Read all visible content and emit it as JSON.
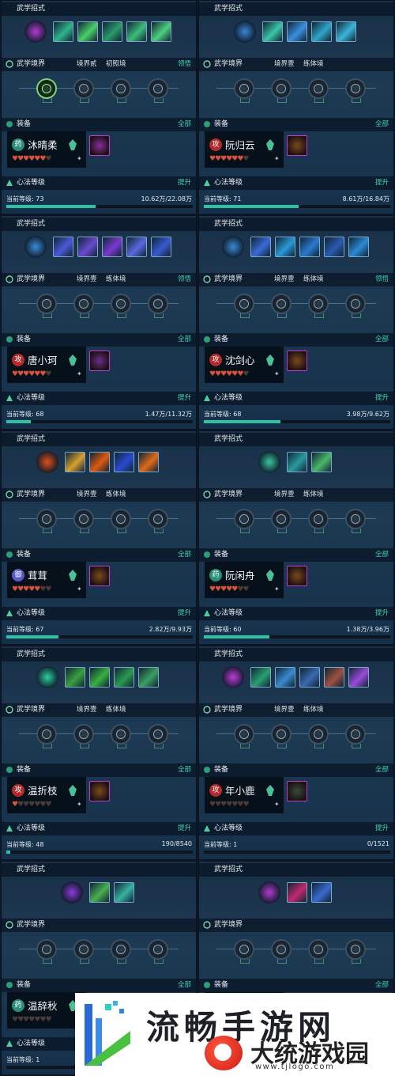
{
  "labels": {
    "skills": "武学招式",
    "realm": "武学境界",
    "equip": "装备",
    "heart": "心法等级",
    "current_level": "当前等级:",
    "insight": "领悟",
    "all": "全部",
    "upgrade": "提升"
  },
  "characters": [
    {
      "realm_a": "境界贰",
      "realm_b": "初照境",
      "show_insight": true,
      "name": "沐晴柔",
      "badge": "药",
      "badge_color": "#2a8f7a",
      "hearts_full": 6,
      "level": "73",
      "exp": "10.62万/22.08万",
      "progress": 0.48,
      "skill_colors": [
        "#b03ad0",
        "#2fb58a",
        "#4ccf6a",
        "#2a9b6a",
        "#3dbd7a",
        "#4fd07e"
      ],
      "gear_color": "#8a2e9c",
      "skill_count": 5
    },
    {
      "realm_a": "境界壹",
      "realm_b": "练体境",
      "show_insight": false,
      "name": "阮归云",
      "badge": "攻",
      "badge_color": "#b22a2a",
      "hearts_full": 6,
      "level": "71",
      "exp": "8.61万/16.84万",
      "progress": 0.51,
      "skill_colors": [
        "#3a86d8",
        "#3cc6a6",
        "#3a8fe0",
        "#2fa6c9",
        "#3ab6d8",
        "#3aa0e0"
      ],
      "gear_color": "#7a4a20",
      "skill_count": 4
    },
    {
      "realm_a": "境界壹",
      "realm_b": "练体境",
      "show_insight": true,
      "name": "唐小珂",
      "badge": "攻",
      "badge_color": "#b22a2a",
      "hearts_full": 6,
      "level": "68",
      "exp": "1.47万/11.32万",
      "progress": 0.13,
      "skill_colors": [
        "#3a8ad8",
        "#4a5ad8",
        "#6a4ad0",
        "#7a3ad0",
        "#5a6ae0",
        "#3a5ad0"
      ],
      "gear_color": "#6a2e8c",
      "skill_count": 5
    },
    {
      "realm_a": "境界壹",
      "realm_b": "练体境",
      "show_insight": true,
      "name": "沈剑心",
      "badge": "攻",
      "badge_color": "#b22a2a",
      "hearts_full": 6,
      "level": "68",
      "exp": "3.98万/9.62万",
      "progress": 0.41,
      "skill_colors": [
        "#3a8ad8",
        "#3a6ad8",
        "#2a9ad8",
        "#2a7ad0",
        "#2a5ab0",
        "#2a8ad8"
      ],
      "gear_color": "#7a4a20",
      "skill_count": 5
    },
    {
      "realm_a": "境界壹",
      "realm_b": "练体境",
      "show_insight": false,
      "name": "茸茸",
      "badge": "御",
      "badge_color": "#5a5ac8",
      "hearts_full": 5,
      "level": "67",
      "exp": "2.82万/9.93万",
      "progress": 0.28,
      "skill_colors": [
        "#e0501a",
        "#d8a030",
        "#e05a10",
        "#2a4ad0",
        "#e06a1a",
        "#000000"
      ],
      "gear_color": "#7a4a20",
      "skill_count": 4
    },
    {
      "realm_a": "境界壹",
      "realm_b": "练体境",
      "show_insight": false,
      "name": "阮闲舟",
      "badge": "药",
      "badge_color": "#2a8f7a",
      "hearts_full": 5,
      "level": "60",
      "exp": "1.38万/3.96万",
      "progress": 0.35,
      "skill_colors": [
        "#3ac6a0",
        "#2a9aa0",
        "#4ab86a",
        "#000000",
        "#000000",
        "#000000"
      ],
      "gear_color": "#7a4a20",
      "skill_count": 2
    },
    {
      "realm_a": "境界壹",
      "realm_b": "练体境",
      "show_insight": false,
      "name": "温折枝",
      "badge": "攻",
      "badge_color": "#b22a2a",
      "hearts_full": 1,
      "level": "48",
      "exp": "190/8540",
      "progress": 0.02,
      "skill_colors": [
        "#2ad0a0",
        "#3aa040",
        "#3ab040",
        "#2a9a50",
        "#3aa060",
        "#000000"
      ],
      "gear_color": "#7a4a20",
      "skill_count": 4
    },
    {
      "realm_a": "境界壹",
      "realm_b": "练体境",
      "show_insight": false,
      "name": "年小鹿",
      "badge": "攻",
      "badge_color": "#b22a2a",
      "hearts_full": 0,
      "level": "1",
      "exp": "0/1521",
      "progress": 0.0,
      "skill_colors": [
        "#c03ad8",
        "#2aa070",
        "#3a8ad0",
        "#3a6ab0",
        "#a05040",
        "#9a4ad8"
      ],
      "gear_color": "#3a4a3a",
      "skill_count": 5
    },
    {
      "realm_a": "",
      "realm_b": "",
      "show_insight": false,
      "name": "温辞秋",
      "badge": "药",
      "badge_color": "#2a8f7a",
      "hearts_full": 0,
      "level": "1",
      "exp": "",
      "progress": 0.0,
      "skill_colors": [
        "#8a3ad8",
        "#4ab050",
        "#3ab0a0",
        "#000000",
        "#000000",
        "#000000"
      ],
      "gear_color": "#3a4a3a",
      "skill_count": 2
    },
    {
      "realm_a": "",
      "realm_b": "",
      "show_insight": false,
      "name": "",
      "badge": "",
      "badge_color": "#000000",
      "hearts_full": 0,
      "level": "",
      "exp": "",
      "progress": 0.0,
      "skill_colors": [
        "#b03ad0",
        "#c02a70",
        "#3a6ad0",
        "#000000",
        "#000000",
        "#000000"
      ],
      "gear_color": "#3a4a3a",
      "skill_count": 2
    }
  ],
  "watermark": {
    "big": "流畅手游网",
    "cn": "大统游戏园",
    "url": "www.tjlogo.com"
  }
}
